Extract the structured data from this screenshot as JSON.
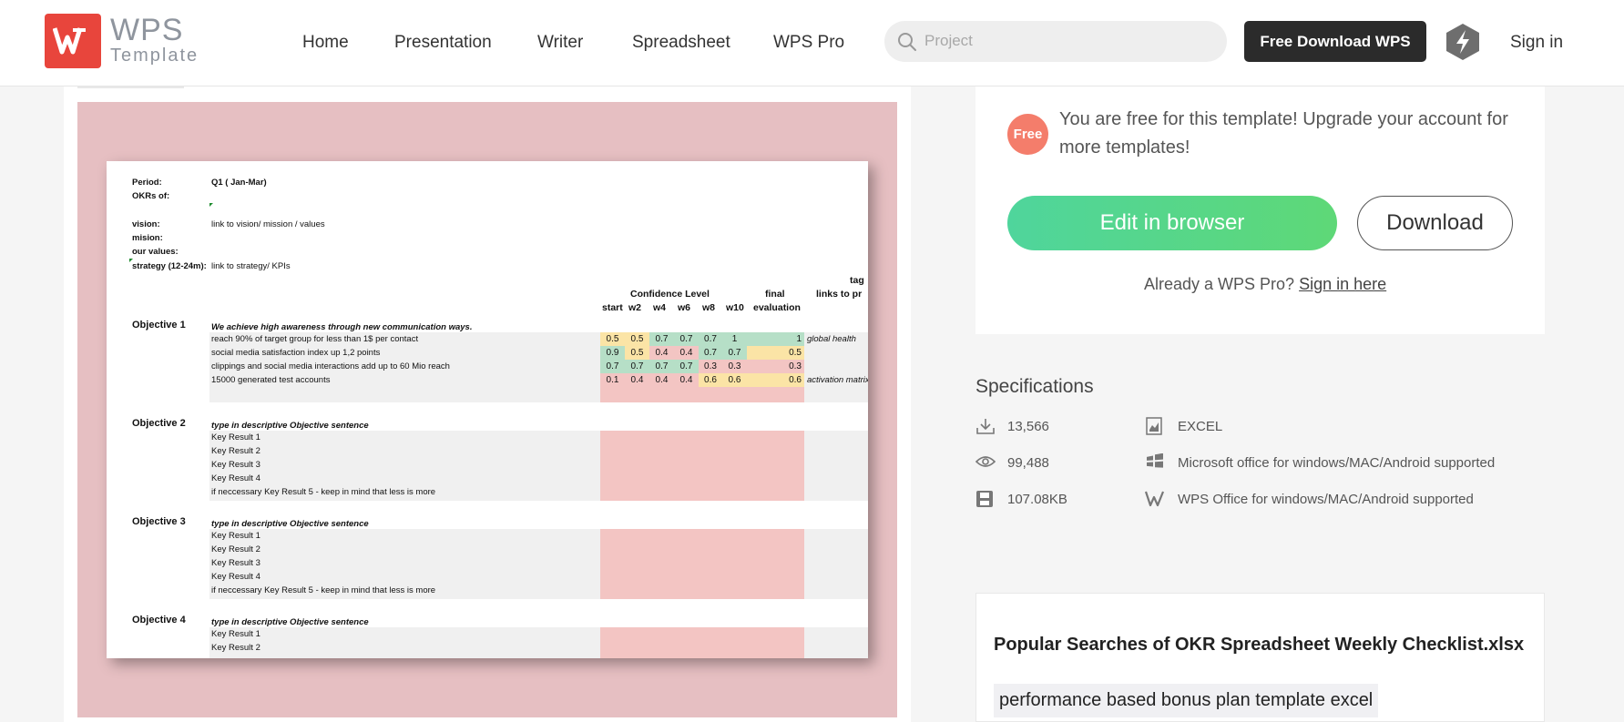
{
  "header": {
    "logo_line1": "WPS",
    "logo_line2": "Template",
    "nav": [
      "Home",
      "Presentation",
      "Writer",
      "Spreadsheet",
      "WPS Pro"
    ],
    "search_placeholder": "Project",
    "free_download_label": "Free Download WPS",
    "signin_label": "Sign in"
  },
  "sheet": {
    "period_label": "Period:",
    "period_value": "Q1 ( Jan-Mar)",
    "okrs_of_label": "OKRs of:",
    "vision_label": "vision:",
    "vision_value": "link to vision/ mission / values",
    "mision_label": "mision:",
    "values_label": "our values:",
    "strategy_label": "strategy (12-24m):",
    "strategy_value": "link to strategy/ KPIs",
    "confidence_header": "Confidence Level",
    "final_header": "final",
    "evaluation_header": "evaluation",
    "tag_header": "tag",
    "links_header": "links to pr",
    "week_headers": [
      "start",
      "w2",
      "w4",
      "w6",
      "w8",
      "w10"
    ],
    "objectives": [
      {
        "label": "Objective 1",
        "sentence": "We achieve high awareness through new communication ways.",
        "key_results": [
          {
            "text": "reach 90% of target group for less than 1$ per contact",
            "values": [
              "0.5",
              "0.5",
              "0.7",
              "0.7",
              "0.7",
              "1"
            ],
            "final": "1",
            "tag": "global health"
          },
          {
            "text": "social media satisfaction index up 1,2 points",
            "values": [
              "0.9",
              "0.5",
              "0.4",
              "0.4",
              "0.7",
              "0.7"
            ],
            "final": "0.5",
            "tag": ""
          },
          {
            "text": "clippings and social media interactions add up to 60 Mio reach",
            "values": [
              "0.7",
              "0.7",
              "0.7",
              "0.7",
              "0.3",
              "0.3"
            ],
            "final": "0.3",
            "tag": ""
          },
          {
            "text": "15000 generated test accounts",
            "values": [
              "0.1",
              "0.4",
              "0.4",
              "0.4",
              "0.6",
              "0.6"
            ],
            "final": "0.6",
            "tag": "activation matrix"
          }
        ]
      },
      {
        "label": "Objective 2",
        "sentence": "type in descriptive Objective sentence",
        "key_results": [
          "Key Result 1",
          "Key Result 2",
          "Key Result 3",
          "Key Result 4",
          "if neccessary Key Result 5 - keep in mind that less is more"
        ]
      },
      {
        "label": "Objective 3",
        "sentence": "type in descriptive Objective sentence",
        "key_results": [
          "Key Result 1",
          "Key Result 2",
          "Key Result 3",
          "Key Result 4",
          "if neccessary Key Result 5 - keep in mind that less is more"
        ]
      },
      {
        "label": "Objective 4",
        "sentence": "type in descriptive Objective sentence",
        "key_results": [
          "Key Result 1",
          "Key Result 2"
        ]
      }
    ],
    "colors": {
      "green": "#b6dfc7",
      "yellow": "#fbe4a6",
      "red": "#f3c5c3",
      "band": "#f0f0f0"
    }
  },
  "sidebar": {
    "free_badge": "Free",
    "free_message": "You are free for this template! Upgrade your account for more templates!",
    "edit_label": "Edit in browser",
    "download_label": "Download",
    "already_text": "Already a WPS Pro?",
    "signin_here": "Sign in here",
    "spec_title": "Specifications",
    "downloads": "13,566",
    "views": "99,488",
    "size": "107.08KB",
    "format": "EXCEL",
    "ms_support": "Microsoft office for windows/MAC/Android supported",
    "wps_support": "WPS Office for windows/MAC/Android supported",
    "popular_title": "Popular Searches of OKR Spreadsheet Weekly Checklist.xlsx",
    "popular_tag": "performance based bonus plan template excel"
  }
}
